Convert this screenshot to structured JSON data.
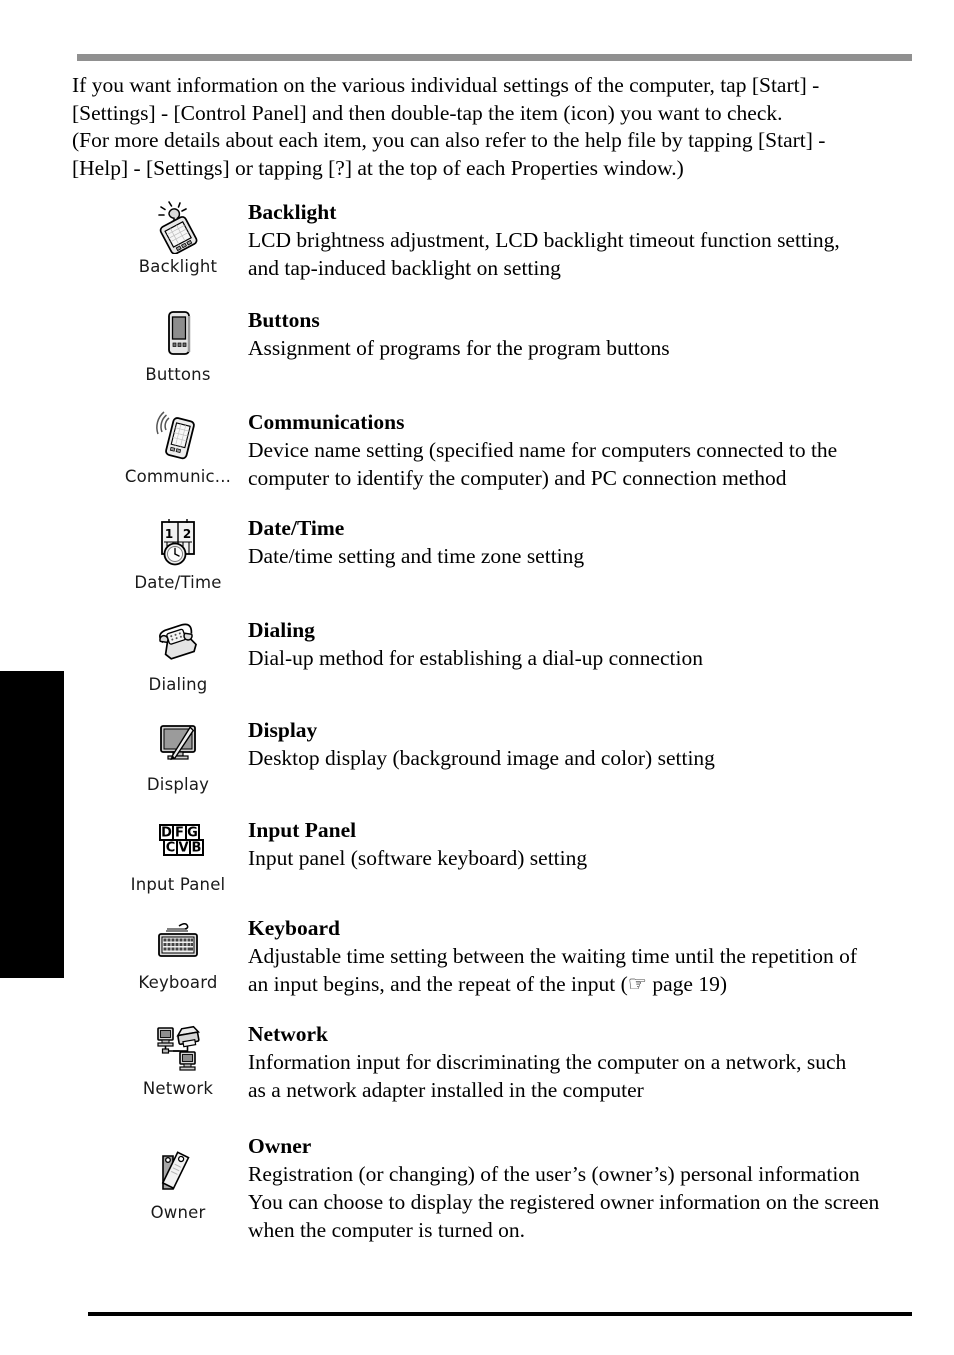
{
  "page": {
    "intro_lines": [
      "If you want information on the various individual settings of the computer, tap [Start] -",
      "[Settings] - [Control Panel] and then double-tap the item (icon) you want to check.",
      "(For more details about each item, you can also refer to the help file by tapping [Start] -",
      "[Help] - [Settings] or tapping [?] at the top of each Properties window.)"
    ],
    "top_rule_color": "#909090",
    "bottom_rule_color": "#000000",
    "edge_tab_color": "#000000"
  },
  "entries": [
    {
      "icon_name": "backlight-icon",
      "icon_caption": "Backlight",
      "title": "Backlight",
      "desc_lines": [
        "LCD brightness adjustment, LCD backlight timeout function setting,",
        "and tap-induced backlight on setting"
      ]
    },
    {
      "icon_name": "buttons-icon",
      "icon_caption": "Buttons",
      "title": "Buttons",
      "desc_lines": [
        "Assignment of programs for the program buttons"
      ]
    },
    {
      "icon_name": "communications-icon",
      "icon_caption": "Communic...",
      "title": "Communications",
      "desc_lines": [
        "Device name setting (specified name for computers connected to the",
        "computer to identify the computer) and PC connection method"
      ]
    },
    {
      "icon_name": "date-time-icon",
      "icon_caption": "Date/Time",
      "title": "Date/Time",
      "desc_lines": [
        "Date/time setting and time zone setting"
      ]
    },
    {
      "icon_name": "dialing-icon",
      "icon_caption": "Dialing",
      "title": "Dialing",
      "desc_lines": [
        "Dial-up method for establishing a dial-up connection"
      ]
    },
    {
      "icon_name": "display-icon",
      "icon_caption": "Display",
      "title": "Display",
      "desc_lines": [
        "Desktop display (background image and color) setting"
      ]
    },
    {
      "icon_name": "input-panel-icon",
      "icon_caption": "Input Panel",
      "title": "Input Panel",
      "desc_lines": [
        "Input panel (software keyboard) setting"
      ]
    },
    {
      "icon_name": "keyboard-icon",
      "icon_caption": "Keyboard",
      "title": "Keyboard",
      "desc_lines": [
        "Adjustable time setting between the waiting time until the repetition of",
        "an input begins, and the repeat of the input (☞ page 19)"
      ]
    },
    {
      "icon_name": "network-icon",
      "icon_caption": "Network",
      "title": "Network",
      "desc_lines": [
        "Information input for discriminating the computer on a network, such",
        "as a network adapter installed in the computer"
      ]
    },
    {
      "icon_name": "owner-icon",
      "icon_caption": "Owner",
      "title": "Owner",
      "desc_lines": [
        "Registration (or changing) of the user’s (owner’s) personal information",
        "You can choose to display the registered owner information on the screen",
        "when the computer is turned on."
      ]
    }
  ],
  "input_panel_icon_keys": {
    "top_row": [
      "D",
      "F",
      "G"
    ],
    "bottom_row": [
      "C",
      "V",
      "B"
    ]
  }
}
